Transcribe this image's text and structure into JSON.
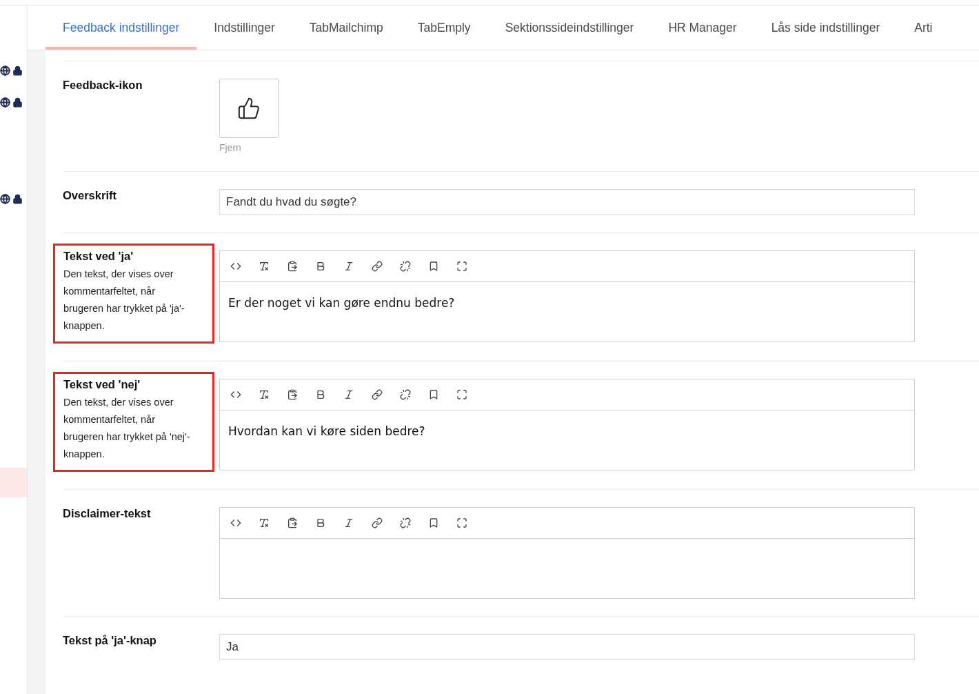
{
  "tabs": [
    {
      "label": "Feedback indstillinger",
      "selected": true
    },
    {
      "label": "Indstillinger",
      "selected": false
    },
    {
      "label": "TabMailchimp",
      "selected": false
    },
    {
      "label": "TabEmply",
      "selected": false
    },
    {
      "label": "Sektionssideindstillinger",
      "selected": false
    },
    {
      "label": "HR Manager",
      "selected": false
    },
    {
      "label": "Lås side indstillinger",
      "selected": false
    },
    {
      "label": "Arti",
      "selected": false
    }
  ],
  "side_markers": [
    {
      "kind": "globe-lock"
    },
    {
      "kind": "globe-lock"
    },
    {
      "kind": "globe-lock"
    },
    {
      "kind": "highlight"
    }
  ],
  "properties": [
    {
      "kind": "image",
      "label": "Feedback-ikon",
      "highlighted": false,
      "remove_link": "Fjern"
    },
    {
      "kind": "text",
      "label": "Overskrift",
      "highlighted": false,
      "value": "Fandt du hvad du søgte?"
    },
    {
      "kind": "richtext",
      "label": "Tekst ved 'ja'",
      "highlighted": true,
      "description": "Den tekst, der vises over kommentarfeltet, når brugeren har trykket på 'ja'-knappen.",
      "value": "Er der noget vi kan gøre endnu bedre?"
    },
    {
      "kind": "richtext",
      "label": "Tekst ved 'nej'",
      "highlighted": true,
      "description": "Den tekst, der vises over kommentarfeltet, når brugeren har trykket på 'nej'-knappen.",
      "value": "Hvordan kan vi køre siden bedre?"
    },
    {
      "kind": "richtext",
      "label": "Disclaimer-tekst",
      "highlighted": false
    },
    {
      "kind": "text",
      "label": "Tekst på 'ja'-knap",
      "highlighted": false,
      "value": "Ja"
    }
  ]
}
